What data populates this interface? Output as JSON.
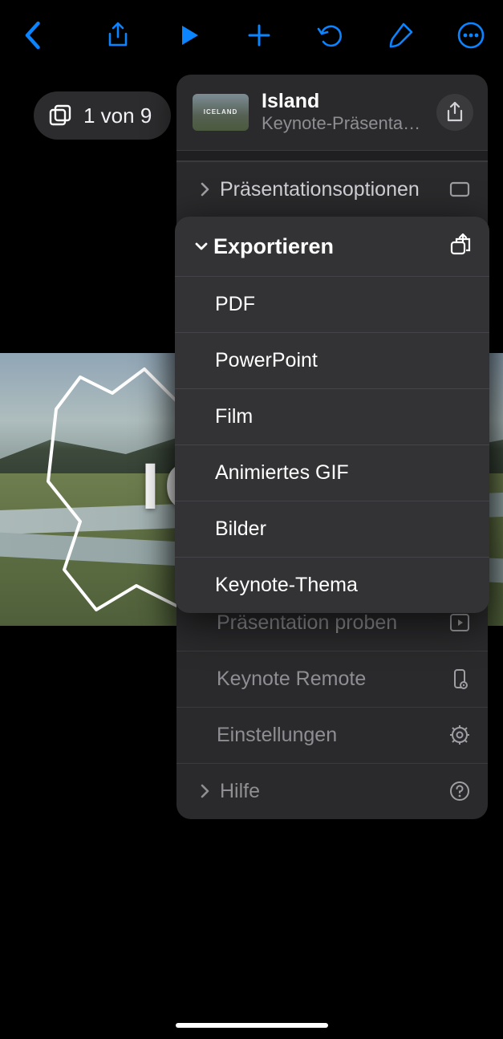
{
  "slide_counter": "1 von 9",
  "slide_title_fragment": "IC",
  "thumb_caption": "ICELAND",
  "doc": {
    "title": "Island",
    "subtitle": "Keynote-Präsentati…"
  },
  "menu": {
    "presentation_options": "Präsentationsoptionen",
    "export": "Exportieren",
    "export_items": {
      "pdf": "PDF",
      "powerpoint": "PowerPoint",
      "movie": "Film",
      "gif": "Animiertes GIF",
      "images": "Bilder",
      "theme": "Keynote-Thema"
    },
    "rehearse": "Präsentation proben",
    "remote": "Keynote Remote",
    "settings": "Einstellungen",
    "help": "Hilfe"
  }
}
